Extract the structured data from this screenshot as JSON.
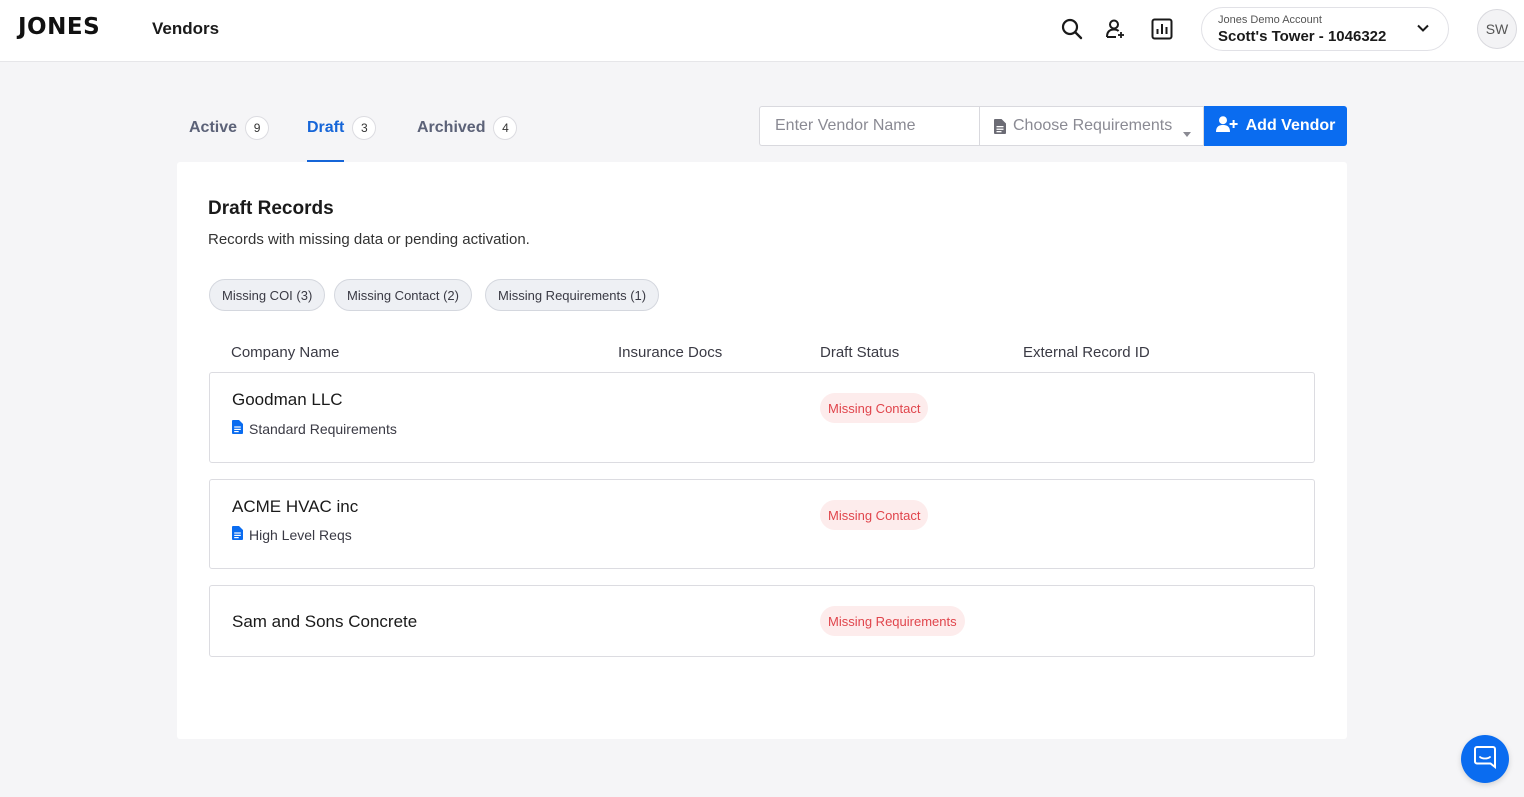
{
  "header": {
    "logo": "JONES",
    "nav_title": "Vendors",
    "icons": [
      "search-icon",
      "user-add-icon",
      "reports-icon"
    ],
    "account": {
      "label": "Jones Demo Account",
      "name": "Scott's Tower - 1046322"
    },
    "avatar_initials": "SW"
  },
  "tabs": [
    {
      "label": "Active",
      "count": "9",
      "active": false
    },
    {
      "label": "Draft",
      "count": "3",
      "active": true
    },
    {
      "label": "Archived",
      "count": "4",
      "active": false
    }
  ],
  "toolbar": {
    "vendor_placeholder": "Enter Vendor Name",
    "requirements_placeholder": "Choose Requirements",
    "add_vendor_label": "Add Vendor"
  },
  "card": {
    "title": "Draft Records",
    "subtitle": "Records with missing data or pending activation.",
    "filters": [
      {
        "label": "Missing COI (3)"
      },
      {
        "label": "Missing Contact (2)"
      },
      {
        "label": "Missing Requirements (1)"
      }
    ],
    "columns": [
      "Company Name",
      "Insurance Docs",
      "Draft Status",
      "External Record ID"
    ],
    "rows": [
      {
        "company": "Goodman LLC",
        "requirements": "Standard Requirements",
        "status": "Missing Contact"
      },
      {
        "company": "ACME HVAC inc",
        "requirements": "High Level Reqs",
        "status": "Missing Contact"
      },
      {
        "company": "Sam and Sons Concrete",
        "requirements": "",
        "status": "Missing Requirements"
      }
    ]
  },
  "colors": {
    "accent": "#0a6cf0",
    "tab_active": "#1565d8",
    "status_bg": "#fdecec",
    "status_text": "#e0454c"
  }
}
